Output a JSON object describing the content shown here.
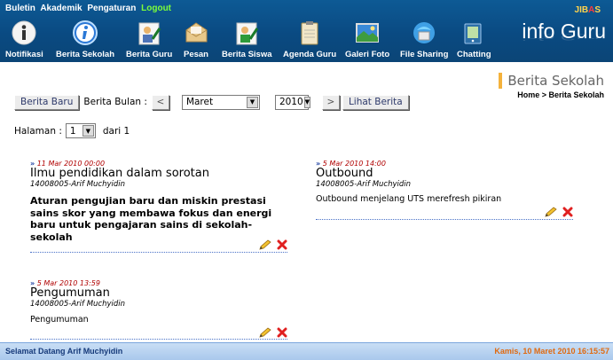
{
  "top_menu": {
    "items": [
      "Buletin",
      "Akademik",
      "Pengaturan"
    ],
    "logout": "Logout"
  },
  "toolbar": [
    {
      "label": "Notifikasi",
      "icon": "info-icon"
    },
    {
      "label": "Berita Sekolah",
      "icon": "info-circle-icon"
    },
    {
      "label": "Berita Guru",
      "icon": "teacher-news-icon"
    },
    {
      "label": "Pesan",
      "icon": "envelope-icon"
    },
    {
      "label": "Berita Siswa",
      "icon": "student-news-icon"
    },
    {
      "label": "Agenda Guru",
      "icon": "clipboard-icon"
    },
    {
      "label": "Galeri Foto",
      "icon": "photo-gallery-icon"
    },
    {
      "label": "File Sharing",
      "icon": "file-sharing-icon"
    },
    {
      "label": "Chatting",
      "icon": "chat-icon"
    }
  ],
  "logo": {
    "jibas_left": "JIB",
    "jibas_mid": "A",
    "jibas_right": "S",
    "title": "info Guru"
  },
  "page": {
    "title": "Berita Sekolah",
    "breadcrumb": "Home > Berita Sekolah"
  },
  "filter": {
    "berita_baru": "Berita Baru",
    "berita_bulan_label": "Berita Bulan :",
    "prev": "<",
    "month": "Maret",
    "year": "2010",
    "next": ">",
    "lihat_berita": "Lihat Berita"
  },
  "pagination": {
    "label": "Halaman :",
    "page": "1",
    "of_text": "dari 1"
  },
  "news": [
    {
      "date": "11 Mar 2010 00:00",
      "title": "Ilmu pendidikan dalam sorotan",
      "author": "14008005-Arif Muchyidin",
      "body": "Aturan pengujian baru dan miskin prestasi sains skor yang membawa fokus dan energi baru untuk pengajaran sains di sekolah-sekolah"
    },
    {
      "date": "5 Mar 2010 14:00",
      "title": "Outbound",
      "author": "14008005-Arif Muchyidin",
      "body": "Outbound menjelang UTS merefresh pikiran"
    },
    {
      "date": "5 Mar 2010 13:59",
      "title": "Pengumuman",
      "author": "14008005-Arif Muchyidin",
      "body": "Pengumuman"
    }
  ],
  "footer": {
    "welcome": "Selamat Datang Arif Muchyidin",
    "datetime": "Kamis, 10 Maret 2010 16:15:57"
  }
}
